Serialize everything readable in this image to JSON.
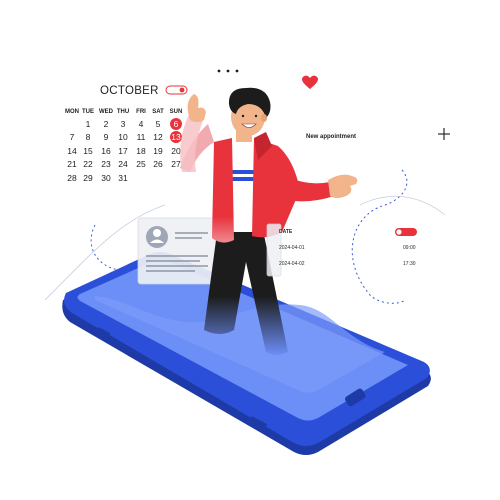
{
  "calendar": {
    "month": "OCTOBER",
    "weekdays": [
      "MON",
      "TUE",
      "WED",
      "THU",
      "FRI",
      "SAT",
      "SUN"
    ],
    "weeks": [
      [
        "",
        "1",
        "2",
        "3",
        "4",
        "5",
        "6"
      ],
      [
        "7",
        "8",
        "9",
        "10",
        "11",
        "12",
        "13"
      ],
      [
        "14",
        "15",
        "16",
        "17",
        "18",
        "19",
        "20"
      ],
      [
        "21",
        "22",
        "23",
        "24",
        "25",
        "26",
        "27"
      ],
      [
        "28",
        "29",
        "30",
        "31",
        "",
        "",
        ""
      ]
    ],
    "highlighted_days": [
      "6",
      "13"
    ]
  },
  "appointment": {
    "title": "New appointment",
    "date_label": "DATE",
    "entries": [
      {
        "date": "2024-04-01",
        "time": "09:00"
      },
      {
        "date": "2024-04-02",
        "time": "17:30"
      }
    ]
  },
  "colors": {
    "accent_red": "#e8323c",
    "phone_blue": "#2b4fd8",
    "screen_blue": "#6c8ef7"
  }
}
